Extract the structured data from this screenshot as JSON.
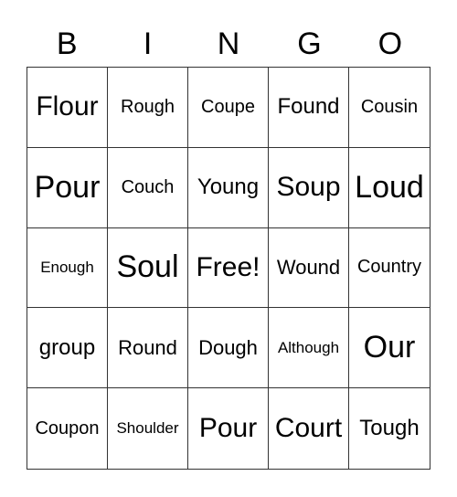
{
  "header": [
    "B",
    "I",
    "N",
    "G",
    "O"
  ],
  "cells": [
    [
      "Flour",
      "Rough",
      "Coupe",
      "Found",
      "Cousin"
    ],
    [
      "Pour",
      "Couch",
      "Young",
      "Soup",
      "Loud"
    ],
    [
      "Enough",
      "Soul",
      "Free!",
      "Wound",
      "Country"
    ],
    [
      "group",
      "Round",
      "Dough",
      "Although",
      "Our"
    ],
    [
      "Coupon",
      "Shoulder",
      "Pour",
      "Court",
      "Tough"
    ]
  ]
}
